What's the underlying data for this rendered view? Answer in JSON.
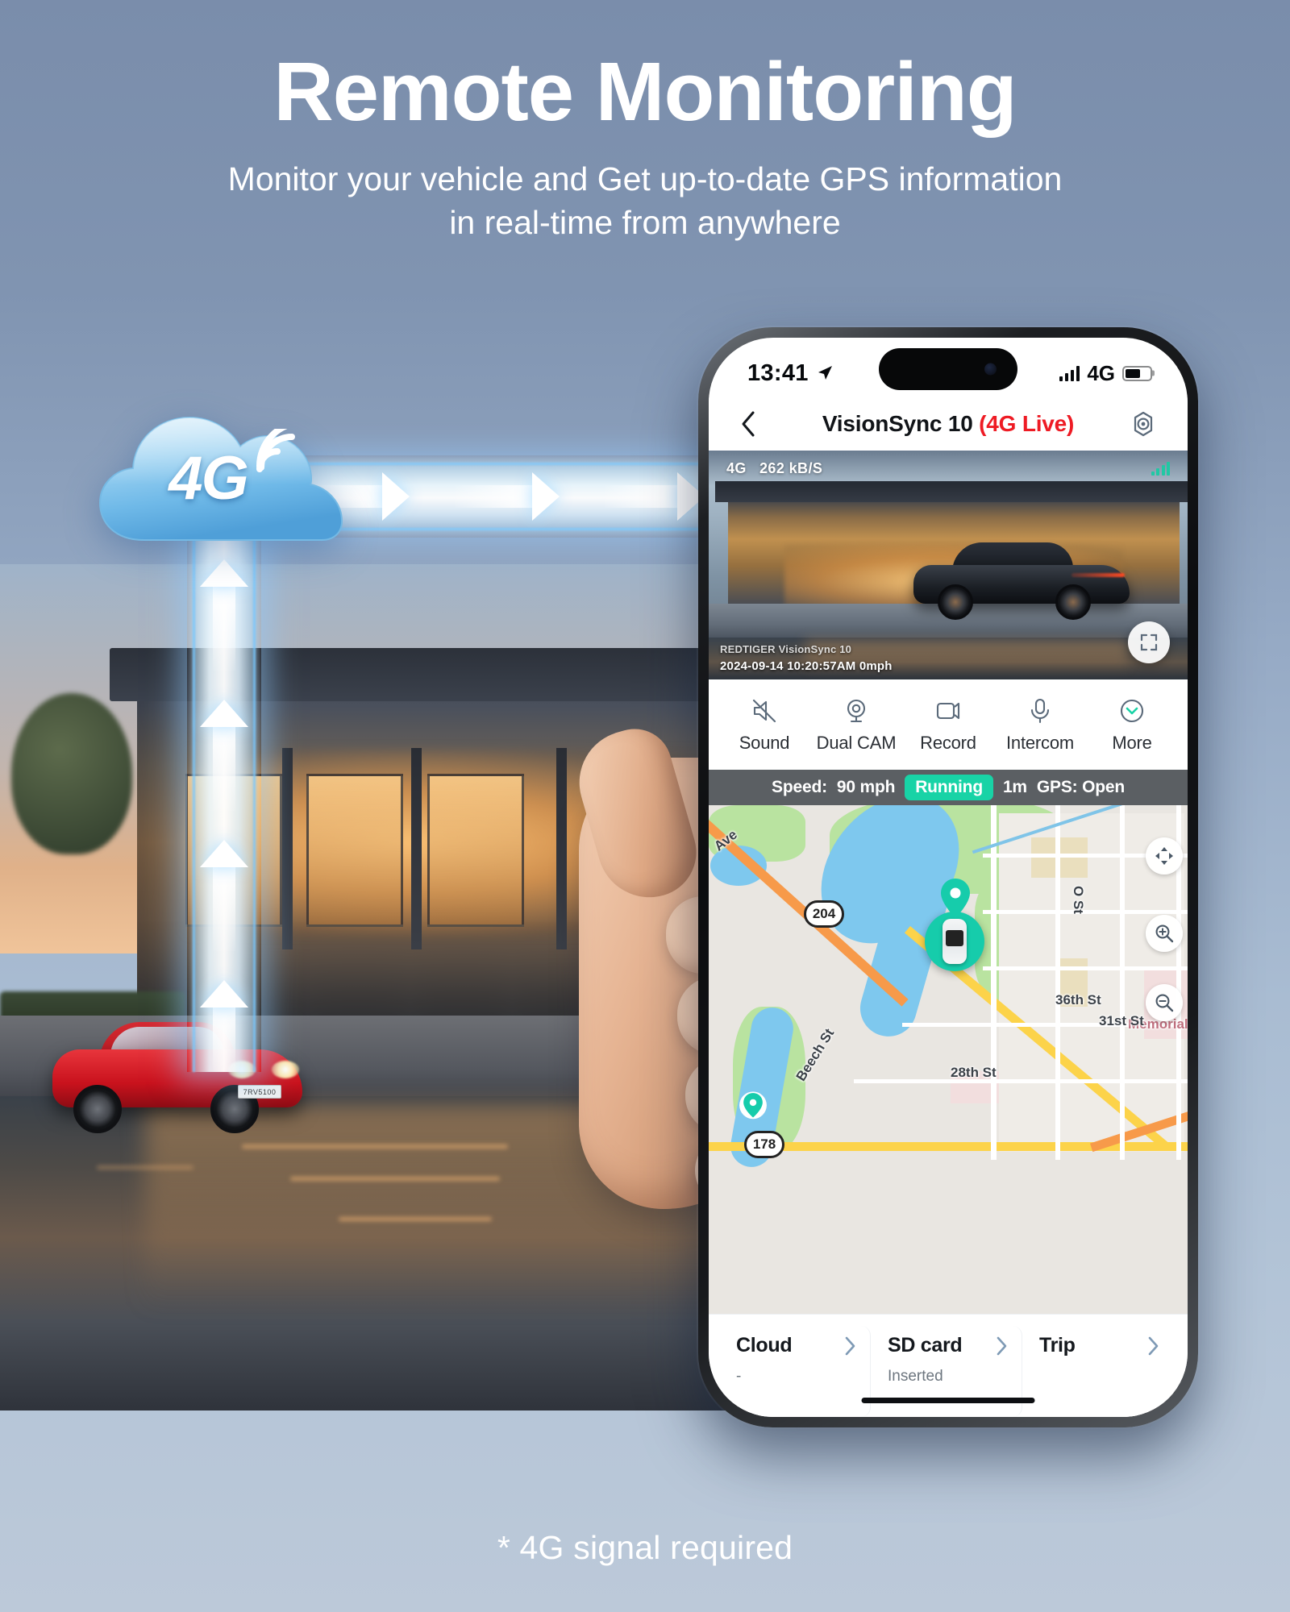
{
  "header": {
    "title": "Remote Monitoring",
    "subtitle_line1": "Monitor your vehicle and Get up-to-date GPS information",
    "subtitle_line2": "in real-time from anywhere"
  },
  "footnote": "* 4G signal required",
  "cloud_graphic": {
    "label": "4G",
    "icon": "cloud-4g-icon",
    "wifi_icon": "wifi-waves-icon",
    "arrows_horizontal": 3,
    "arrows_vertical": 4
  },
  "phone": {
    "status_bar": {
      "time": "13:41",
      "location_icon": "location-arrow-icon",
      "signal_icon": "signal-bars-icon",
      "network": "4G",
      "battery_icon": "battery-icon"
    },
    "nav": {
      "back_icon": "chevron-left-icon",
      "title": "VisionSync 10",
      "title_live": "(4G Live)",
      "settings_icon": "settings-gear-icon"
    },
    "feed": {
      "network": "4G",
      "bitrate": "262 kB/S",
      "signal_icon": "signal-bars-icon",
      "watermark": "REDTIGER VisionSync 10",
      "timestamp": "2024-09-14 10:20:57AM 0mph",
      "fullscreen_icon": "fullscreen-expand-icon"
    },
    "toolbar": [
      {
        "label": "Sound",
        "icon": "speaker-muted-icon"
      },
      {
        "label": "Dual CAM",
        "icon": "camera-pin-icon"
      },
      {
        "label": "Record",
        "icon": "video-record-icon"
      },
      {
        "label": "Intercom",
        "icon": "microphone-icon"
      },
      {
        "label": "More",
        "icon": "chevron-down-circle-icon"
      }
    ],
    "speed_strip": {
      "speed_label": "Speed:",
      "speed_value": "90 mph",
      "status_badge": "Running",
      "duration": "1m",
      "gps": "GPS: Open"
    },
    "map": {
      "labels": [
        "Ave",
        "O St",
        "36th St",
        "Memorial H",
        "Beech St",
        "28th St",
        "31st St"
      ],
      "shields": [
        "204",
        "178"
      ],
      "controls": [
        {
          "icon": "move-pan-icon"
        },
        {
          "icon": "zoom-in-icon"
        },
        {
          "icon": "zoom-out-icon"
        }
      ],
      "vehicle_marker_icon": "car-top-view-icon",
      "pin_icon": "map-pin-icon"
    },
    "cards": [
      {
        "title": "Cloud",
        "subtitle": "-",
        "chevron": "chevron-right-icon"
      },
      {
        "title": "SD card",
        "subtitle": "Inserted",
        "chevron": "chevron-right-icon"
      },
      {
        "title": "Trip",
        "subtitle": "",
        "chevron": "chevron-right-icon"
      }
    ]
  },
  "hero_scene": {
    "vehicle": "red-sports-car",
    "license_plate": "7RV5100",
    "building": "modern-villa"
  },
  "colors": {
    "accent_teal": "#18d3a6",
    "live_red": "#ee1b24",
    "beam_blue": "#7dcaff",
    "background_top": "#7a8dab",
    "background_bottom": "#bcc9d9"
  }
}
